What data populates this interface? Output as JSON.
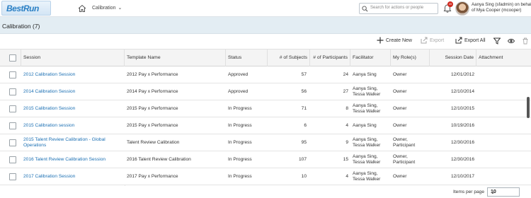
{
  "header": {
    "logo_text": "BestRun",
    "nav_label": "Calibration",
    "search_placeholder": "Search for actions or people",
    "notification_count": "20",
    "user_line1": "Aanya Sing (sfadmin) on behalf",
    "user_line2": "of Mya Cooper (mcooper)"
  },
  "page": {
    "title": "Calibration (7)"
  },
  "toolbar": {
    "create_label": "Create New",
    "export_label": "Export",
    "export_all_label": "Export All"
  },
  "table": {
    "columns": [
      "Session",
      "Template Name",
      "Status",
      "# of Subjects",
      "# of Participants",
      "Facilitator",
      "My Role(s)",
      "Session Date",
      "Attachment"
    ],
    "rows": [
      {
        "session": "2012 Calibration Session",
        "template": "2012 Pay x Performance",
        "status": "Approved",
        "subjects": "57",
        "participants": "24",
        "facilitator": "Aanya Sing",
        "roles": "Owner",
        "date": "12/01/2012"
      },
      {
        "session": "2014 Calibration Session",
        "template": "2014 Pay x Performance",
        "status": "Approved",
        "subjects": "56",
        "participants": "27",
        "facilitator": "Aanya Sing, Tessa Walker",
        "roles": "Owner",
        "date": "12/10/2014"
      },
      {
        "session": "2015 Calibration Session",
        "template": "2015 Pay x Performance",
        "status": "In Progress",
        "subjects": "71",
        "participants": "8",
        "facilitator": "Aanya Sing, Tessa Walker",
        "roles": "Owner",
        "date": "12/10/2015"
      },
      {
        "session": "2015 Calibration session",
        "template": "2015 Pay x Performance",
        "status": "In Progress",
        "subjects": "6",
        "participants": "4",
        "facilitator": "Aanya Sing",
        "roles": "Owner",
        "date": "10/19/2016"
      },
      {
        "session": "2015 Talent Review Calibration - Global Operations",
        "template": "Talent Review Calibration",
        "status": "In Progress",
        "subjects": "95",
        "participants": "9",
        "facilitator": "Aanya Sing, Tessa Walker",
        "roles": "Owner, Participant",
        "date": "12/30/2016"
      },
      {
        "session": "2016 Talent Review Calibration Session",
        "template": "2016 Talent Review Calibration",
        "status": "In Progress",
        "subjects": "107",
        "participants": "15",
        "facilitator": "Aanya Sing, Tessa Walker",
        "roles": "Owner, Participant",
        "date": "12/30/2016"
      },
      {
        "session": "2017 Calibration Session",
        "template": "2017 Pay x Performance",
        "status": "In Progress",
        "subjects": "10",
        "participants": "4",
        "facilitator": "Aanya Sing, Tessa Walker",
        "roles": "Owner",
        "date": "12/10/2017"
      }
    ]
  },
  "footer": {
    "items_per_page_label": "Items per page",
    "items_per_page_value": "10"
  },
  "colors": {
    "link": "#1a6fb3",
    "title_bar": "#e3edf3",
    "badge": "#d0271d"
  }
}
